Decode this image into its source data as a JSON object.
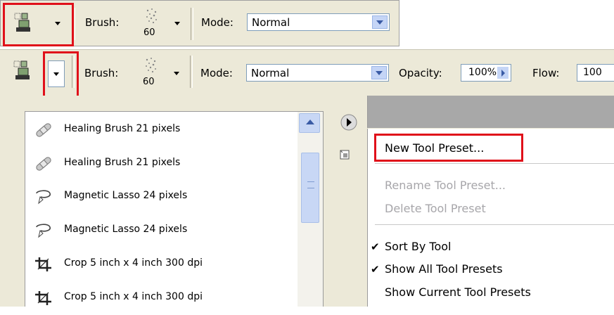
{
  "toolbar_top": {
    "brush_label": "Brush:",
    "brush_size": "60",
    "mode_label": "Mode:",
    "mode_value": "Normal"
  },
  "toolbar_main": {
    "brush_label": "Brush:",
    "brush_size": "60",
    "mode_label": "Mode:",
    "mode_value": "Normal",
    "opacity_label": "Opacity:",
    "opacity_value": "100%",
    "flow_label": "Flow:",
    "flow_value": "100"
  },
  "presets": [
    {
      "label": "Healing Brush 21 pixels",
      "icon": "bandage-icon"
    },
    {
      "label": "Healing Brush 21 pixels",
      "icon": "bandage-icon"
    },
    {
      "label": "Magnetic Lasso 24 pixels",
      "icon": "magnetic-lasso-icon"
    },
    {
      "label": "Magnetic Lasso 24 pixels",
      "icon": "magnetic-lasso-icon"
    },
    {
      "label": "Crop 5 inch x 4 inch 300 dpi",
      "icon": "crop-icon"
    },
    {
      "label": "Crop 5 inch x 4 inch 300 dpi",
      "icon": "crop-icon"
    }
  ],
  "menu": {
    "new_preset": "New Tool Preset...",
    "rename_preset": "Rename Tool Preset...",
    "delete_preset": "Delete Tool Preset",
    "sort_by_tool": "Sort By Tool",
    "show_all": "Show All Tool Presets",
    "show_current": "Show Current Tool Presets",
    "check_glyph": "✔"
  },
  "colors": {
    "highlight": "#e0101a",
    "panel": "#ece9d8",
    "disabled_text": "#a7a6aa"
  }
}
